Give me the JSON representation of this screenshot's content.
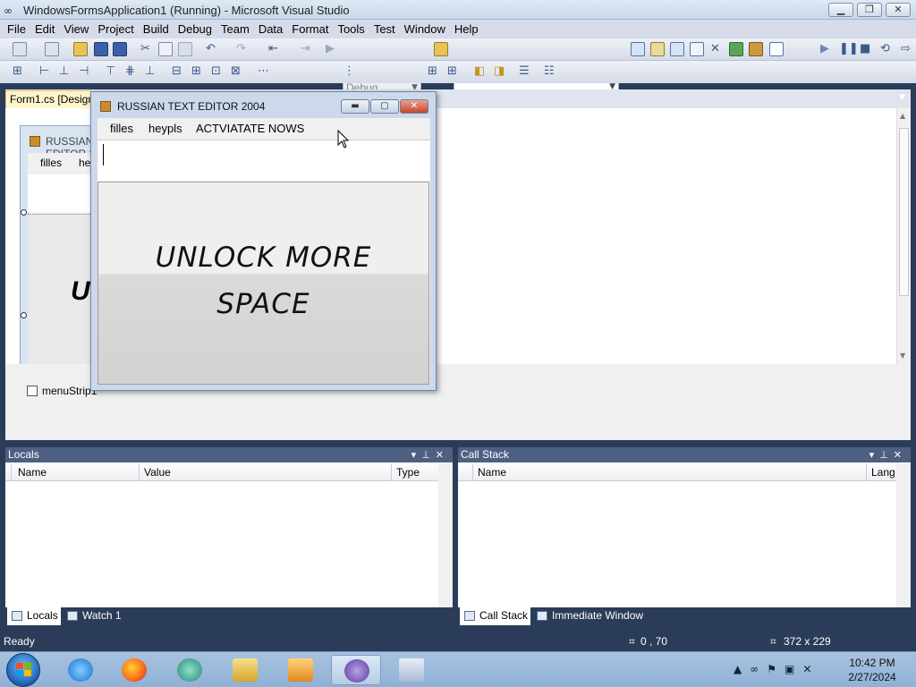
{
  "vs": {
    "title": "WindowsFormsApplication1 (Running) - Microsoft Visual Studio",
    "logo_icon": "infinity-icon",
    "menu": [
      "File",
      "Edit",
      "View",
      "Project",
      "Build",
      "Debug",
      "Team",
      "Data",
      "Format",
      "Tools",
      "Test",
      "Window",
      "Help"
    ],
    "config": "Debug",
    "platform": "",
    "doc_tab": "Form1.cs [Design]",
    "tray_component": "menuStrip1"
  },
  "design_form": {
    "title": "RUSSIAN TEXT EDITOR 2004",
    "menu1": "filles",
    "menu2": "heypls",
    "pic_fragment": "U"
  },
  "app": {
    "title": "RUSSIAN TEXT EDITOR 2004",
    "menu": [
      "filles",
      "heypls",
      "ACTVIATATE NOWS"
    ],
    "textbox_value": "",
    "banner_line1": "UNLOCK MORE",
    "banner_line2": "SPACE"
  },
  "locals": {
    "title": "Locals",
    "columns": [
      "Name",
      "Value",
      "Type"
    ],
    "tabs": [
      "Locals",
      "Watch 1"
    ]
  },
  "callstack": {
    "title": "Call Stack",
    "columns": [
      "Name",
      "Lang"
    ],
    "tabs": [
      "Call Stack",
      "Immediate Window"
    ]
  },
  "status": {
    "text": "Ready",
    "position": "0 , 70",
    "size": "372 x 229"
  },
  "taskbar": {
    "time": "10:42 PM",
    "date": "2/27/2024"
  },
  "colors": {
    "vs_chrome": "#2b3c59",
    "panel_header": "#4d6082",
    "doc_tab": "#fff5cc"
  }
}
